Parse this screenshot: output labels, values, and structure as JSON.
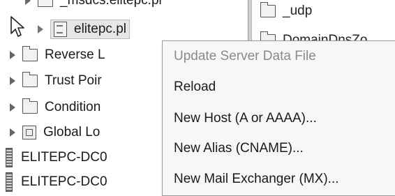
{
  "tree": {
    "partial_top_label": "_msdcs.elitepc.pl",
    "items": [
      {
        "label": "elitepc.pl",
        "type": "zone"
      },
      {
        "label": "Reverse L",
        "type": "folder"
      },
      {
        "label": "Trust Poir",
        "type": "folder"
      },
      {
        "label": "Condition",
        "type": "folder"
      },
      {
        "label": "Global Lo",
        "type": "log"
      },
      {
        "label": "ELITEPC-DC0",
        "type": "server"
      },
      {
        "label": "ELITEPC-DC0",
        "type": "server"
      }
    ]
  },
  "right_pane": {
    "items": [
      {
        "label": "_udp"
      },
      {
        "label": "DomainDnsZo"
      }
    ]
  },
  "context_menu": {
    "items": [
      {
        "label": "Update Server Data File",
        "enabled": false
      },
      {
        "label": "Reload",
        "enabled": true
      },
      {
        "label": "New Host (A or AAAA)...",
        "enabled": true
      },
      {
        "label": "New Alias (CNAME)...",
        "enabled": true
      },
      {
        "label": "New Mail Exchanger (MX)...",
        "enabled": true
      }
    ]
  }
}
